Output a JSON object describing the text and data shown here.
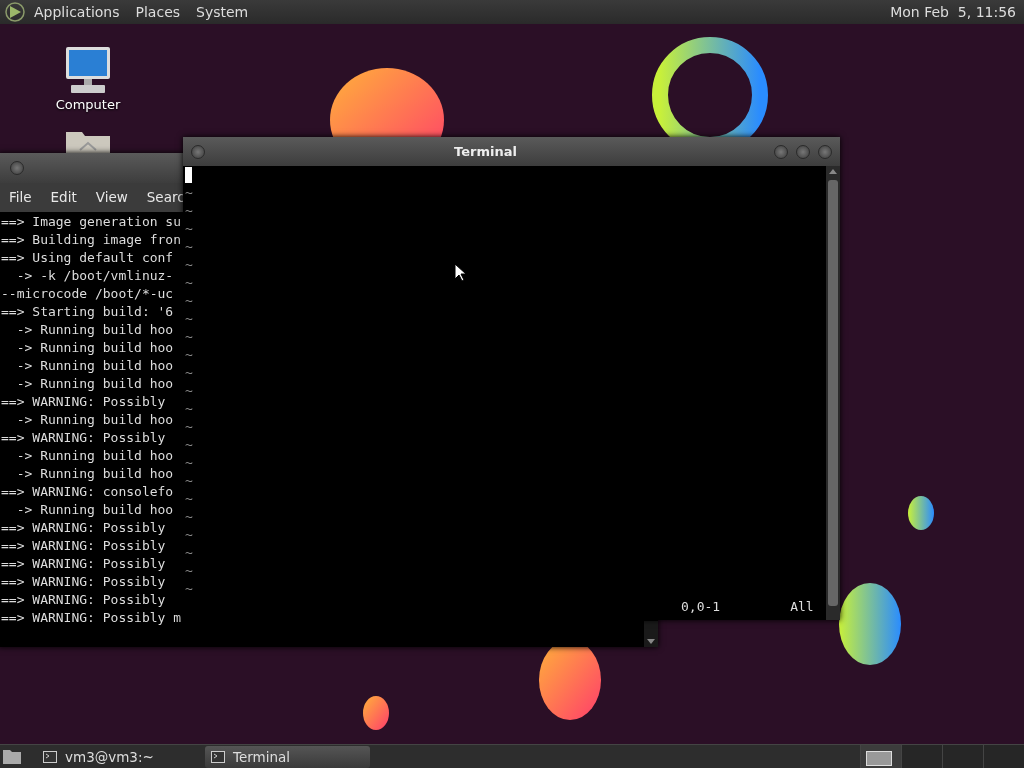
{
  "top_panel": {
    "menus": [
      "Applications",
      "Places",
      "System"
    ],
    "clock": "Mon Feb  5, 11:56"
  },
  "desktop_icons": [
    {
      "label": "Computer"
    }
  ],
  "back_window": {
    "menu": [
      "File",
      "Edit",
      "View",
      "Searc"
    ],
    "lines": [
      "==> Image generation su",
      "==> Building image fron",
      "==> Using default conf",
      "  -> -k /boot/vmlinuz-",
      "--microcode /boot/*-uc",
      "==> Starting build: '6",
      "  -> Running build hoo",
      "  -> Running build hoo",
      "  -> Running build hoo",
      "  -> Running build hoo",
      "==> WARNING: Possibly",
      "  -> Running build hoo",
      "==> WARNING: Possibly",
      "  -> Running build hoo",
      "  -> Running build hoo",
      "==> WARNING: consolefo",
      "  -> Running build hoo",
      "==> WARNING: Possibly",
      "==> WARNING: Possibly",
      "==> WARNING: Possibly",
      "==> WARNING: Possibly",
      "==> WARNING: Possibly",
      "==> WARNING: Possibly m"
    ]
  },
  "front_window": {
    "title": "Terminal",
    "empty_lines": [
      "~",
      "~",
      "~",
      "~",
      "~",
      "~",
      "~",
      "~",
      "~",
      "~",
      "~",
      "~",
      "~",
      "~",
      "~",
      "~",
      "~",
      "~",
      "~",
      "~",
      "~",
      "~",
      "~"
    ],
    "position": "0,0-1",
    "scroll": "All"
  },
  "taskbar": [
    {
      "label": "vm3@vm3:~",
      "selected": false
    },
    {
      "label": "Terminal",
      "selected": true
    }
  ]
}
